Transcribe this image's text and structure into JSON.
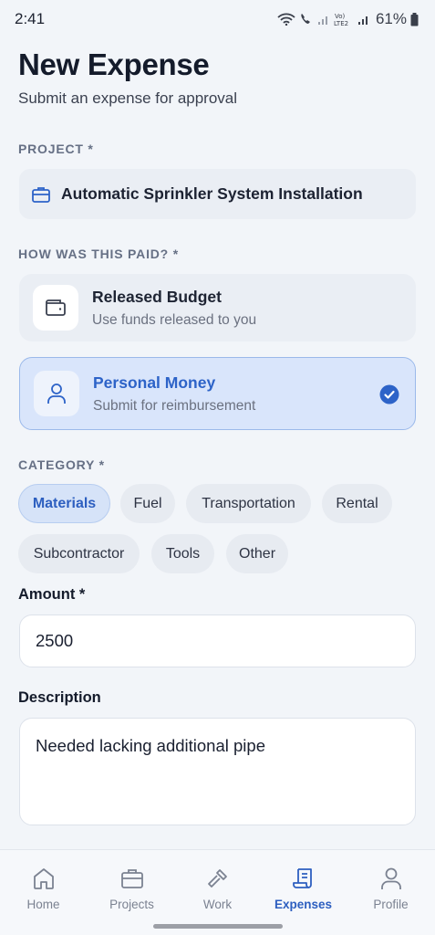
{
  "status_bar": {
    "time": "2:41",
    "battery": "61%"
  },
  "header": {
    "title": "New Expense",
    "subtitle": "Submit an expense for approval"
  },
  "project": {
    "label": "PROJECT *",
    "value": "Automatic Sprinkler System Installation",
    "icon": "briefcase-icon"
  },
  "payment": {
    "label": "HOW WAS THIS PAID? *",
    "options": [
      {
        "title": "Released Budget",
        "description": "Use funds released to you",
        "icon": "wallet-icon",
        "selected": false
      },
      {
        "title": "Personal Money",
        "description": "Submit for reimbursement",
        "icon": "user-icon",
        "selected": true
      }
    ]
  },
  "category": {
    "label": "CATEGORY *",
    "chips": [
      "Materials",
      "Fuel",
      "Transportation",
      "Rental",
      "Subcontractor",
      "Tools",
      "Other"
    ],
    "selected": "Materials"
  },
  "amount": {
    "label": "Amount *",
    "value": "2500"
  },
  "description": {
    "label": "Description",
    "value": "Needed lacking additional pipe"
  },
  "bottom_nav": {
    "items": [
      {
        "label": "Home",
        "icon": "home-icon"
      },
      {
        "label": "Projects",
        "icon": "briefcase-icon"
      },
      {
        "label": "Work",
        "icon": "hammer-icon"
      },
      {
        "label": "Expenses",
        "icon": "receipt-icon"
      },
      {
        "label": "Profile",
        "icon": "user-icon"
      }
    ],
    "active": "Expenses"
  },
  "colors": {
    "accent": "#2d63c8",
    "selected_card_bg": "#d9e5fb",
    "background": "#f2f5f9"
  }
}
